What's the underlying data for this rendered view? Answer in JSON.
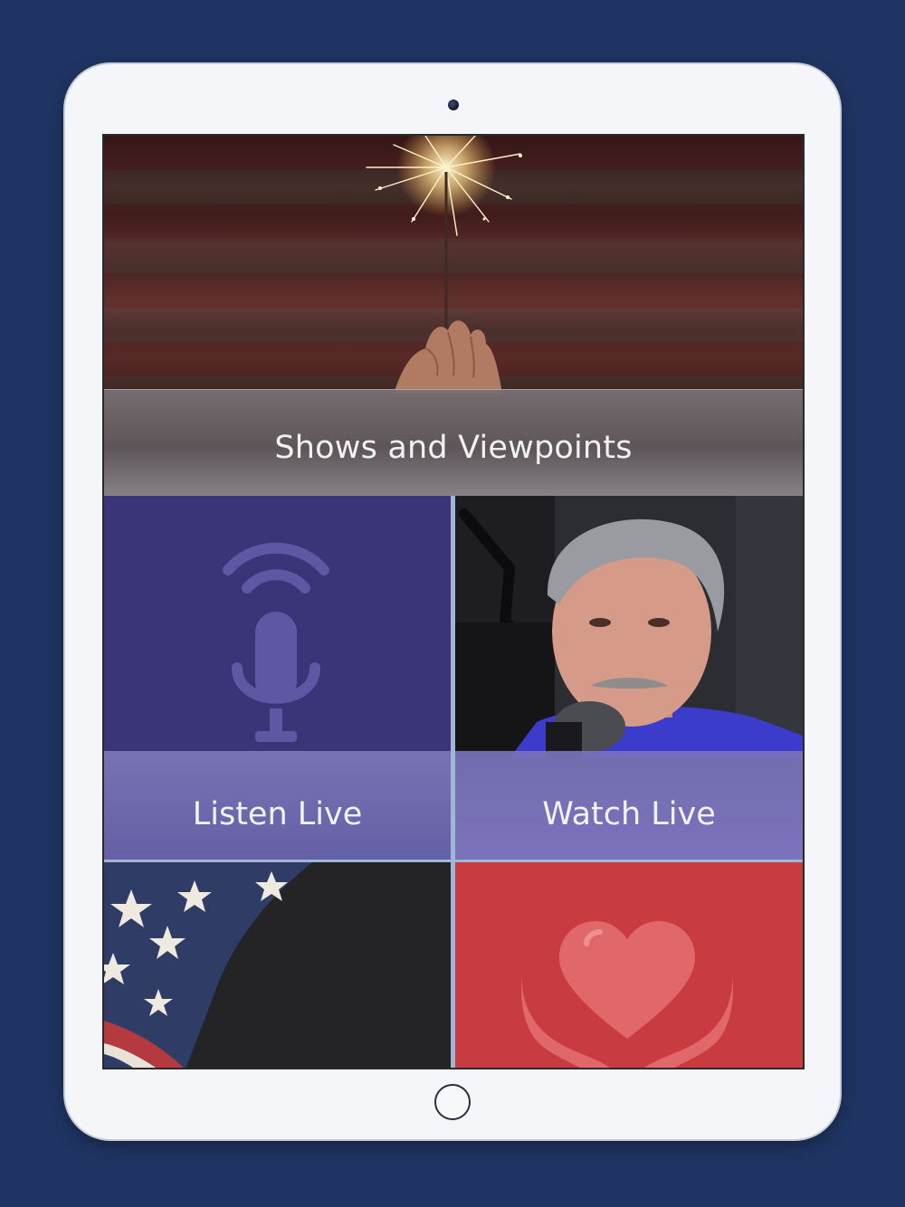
{
  "banner": {
    "title": "Shows and Viewpoints"
  },
  "tiles": {
    "listen": {
      "label": "Listen Live",
      "icon": "microphone-broadcast-icon"
    },
    "watch": {
      "label": "Watch Live"
    },
    "flag": {
      "icon": "american-flag-image"
    },
    "give": {
      "icon": "heart-in-hands-icon"
    }
  },
  "colors": {
    "background": "#1f3462",
    "listen_tile": "#3a3478",
    "give_tile": "#c83b40",
    "accent_divider": "#9fb7d4"
  }
}
